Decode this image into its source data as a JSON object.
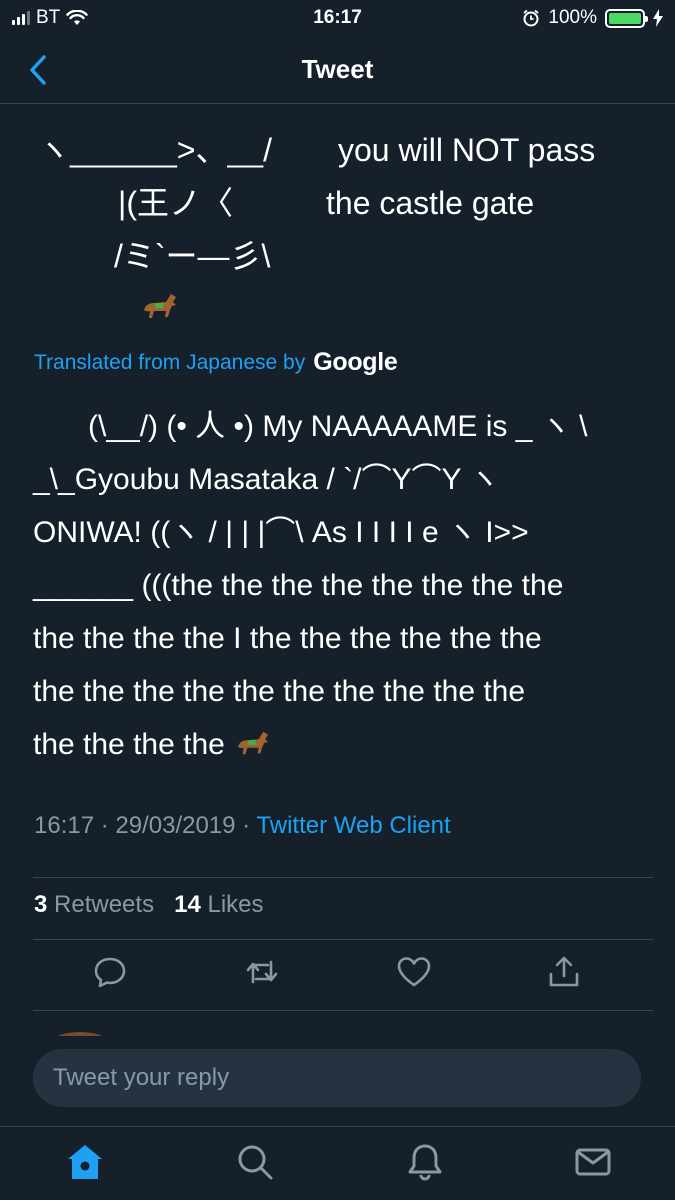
{
  "status_bar": {
    "carrier": "BT",
    "time": "16:17",
    "battery": "100%"
  },
  "header": {
    "title": "Tweet"
  },
  "tweet": {
    "ascii_lines": [
      "ヽ______>、__/",
      "|(王ノ〈",
      "/ミ`ー―彡\\"
    ],
    "ascii_captions": [
      "you will NOT pass",
      "the castle gate"
    ],
    "translated_label": "Translated from Japanese by",
    "translated_brand": "Google",
    "translation_lines": [
      "(\\__/) (• 人 •) My NAAAAAME is _ ヽ \\",
      "_\\_Gyoubu Masataka / `/⌒Y⌒Y ヽ",
      "ONIWA! ((ヽ / | | |⌒\\ As I I I I e ヽ I>>",
      "______ (((the the the the the the the the",
      "the the the the I the the the the the the",
      "the the the the the the the the the the",
      "the the the the"
    ],
    "timestamp": "16:17 · 29/03/2019 · ",
    "client": "Twitter Web Client",
    "retweets_count": "3",
    "retweets_label": "Retweets",
    "likes_count": "14",
    "likes_label": "Likes"
  },
  "reply": {
    "placeholder": "Tweet your reply"
  },
  "icons": {
    "back": "chevron-left-icon",
    "reply": "speech-bubble-icon",
    "retweet": "retweet-icon",
    "like": "heart-icon",
    "share": "share-icon",
    "home": "home-icon",
    "search": "search-icon",
    "notifications": "bell-icon",
    "messages": "envelope-icon"
  },
  "colors": {
    "background": "#15202b",
    "accent": "#1da1f2",
    "muted": "#8899a6",
    "divider": "#38444d",
    "battery": "#4cd964"
  }
}
